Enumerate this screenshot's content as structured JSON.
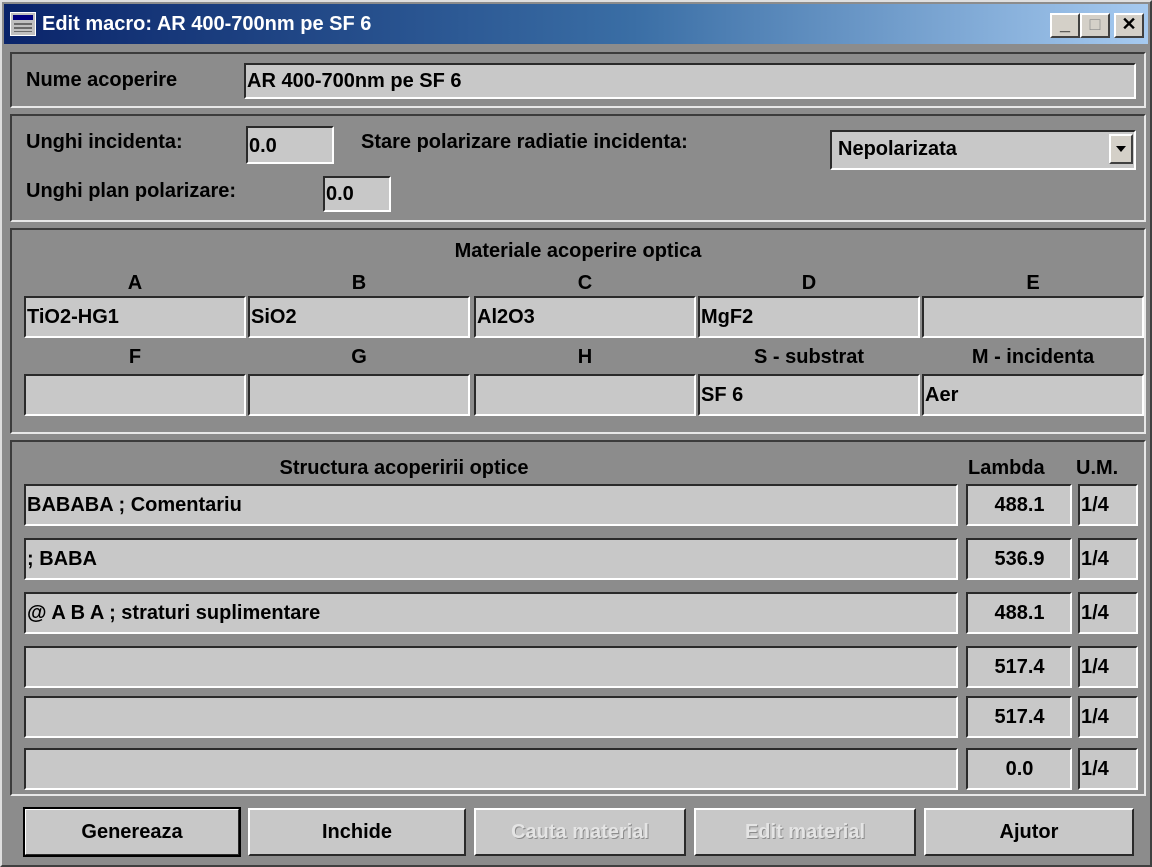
{
  "window": {
    "title": "Edit macro: AR 400-700nm pe SF 6",
    "min_glyph": "_",
    "max_glyph": "□",
    "close_glyph": "✕"
  },
  "coating_name": {
    "label": "Nume acoperire",
    "value": "AR 400-700nm pe SF 6"
  },
  "incidence": {
    "angle_label": "Unghi incidenta:",
    "angle_value": "0.0",
    "polarization_state_label": "Stare polarizare radiatie incidenta:",
    "polarization_state_value": "Nepolarizata",
    "plane_angle_label": "Unghi plan polarizare:",
    "plane_angle_value": "0.0"
  },
  "materials": {
    "title": "Materiale acoperire optica",
    "row1": [
      {
        "header": "A",
        "value": "TiO2-HG1"
      },
      {
        "header": "B",
        "value": "SiO2"
      },
      {
        "header": "C",
        "value": "Al2O3"
      },
      {
        "header": "D",
        "value": "MgF2"
      },
      {
        "header": "E",
        "value": ""
      }
    ],
    "row2": [
      {
        "header": "F",
        "value": ""
      },
      {
        "header": "G",
        "value": ""
      },
      {
        "header": "H",
        "value": ""
      },
      {
        "header": "S - substrat",
        "value": "SF 6"
      },
      {
        "header": "M -  incidenta",
        "value": "Aer"
      }
    ]
  },
  "structure": {
    "title": "Structura acoperirii optice",
    "lambda_header": "Lambda",
    "um_header": "U.M.",
    "rows": [
      {
        "text": "BABABA    ;  Comentariu",
        "lambda": "488.1",
        "um": "1/4"
      },
      {
        "text": "; BABA",
        "lambda": "536.9",
        "um": "1/4"
      },
      {
        "text": "@ A B A    ; straturi suplimentare",
        "lambda": "488.1",
        "um": "1/4"
      },
      {
        "text": "",
        "lambda": "517.4",
        "um": "1/4"
      },
      {
        "text": "",
        "lambda": "517.4",
        "um": "1/4"
      },
      {
        "text": "",
        "lambda": "0.0",
        "um": "1/4"
      }
    ]
  },
  "buttons": {
    "generate": "Genereaza",
    "close": "Inchide",
    "find_material": "Cauta material",
    "edit_material": "Edit material",
    "help": "Ajutor"
  }
}
